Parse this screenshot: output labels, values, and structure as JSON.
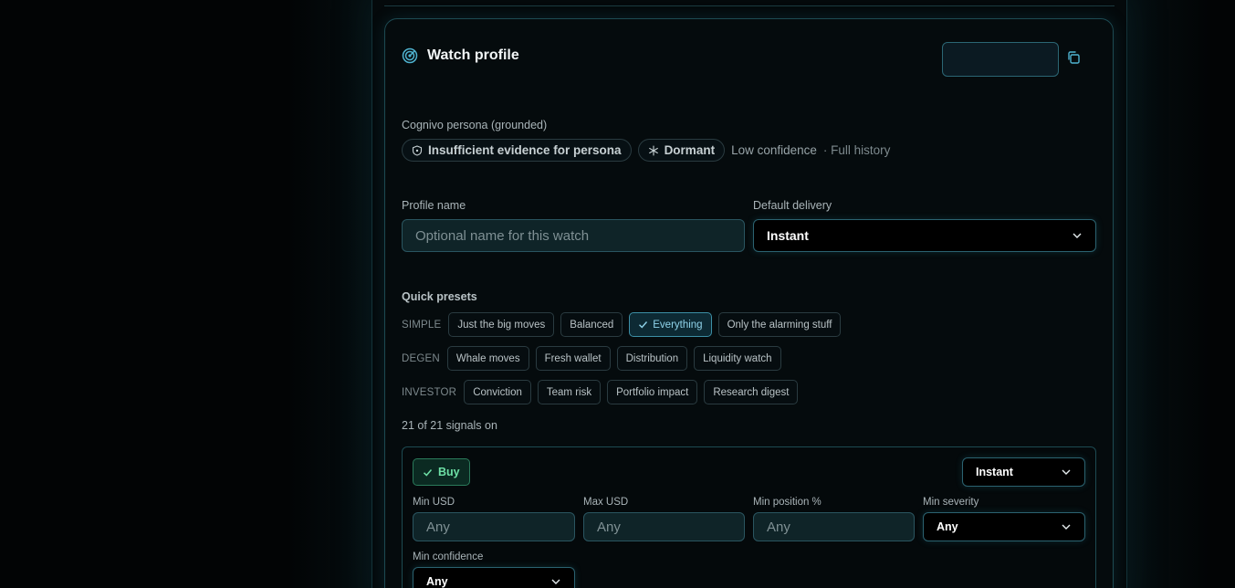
{
  "watch_profile": {
    "title": "Watch profile",
    "icons": {
      "title": "radar-icon",
      "copy": "copy-icon"
    }
  },
  "persona": {
    "label": "Cognivo persona (grounded)",
    "evidence_pill": "Insufficient evidence for persona",
    "state_pill": "Dormant",
    "confidence": "Low confidence",
    "history": "· Full history"
  },
  "profile_name": {
    "label": "Profile name",
    "placeholder": "Optional name for this watch"
  },
  "default_delivery": {
    "label": "Default delivery",
    "value": "Instant"
  },
  "quick_presets": {
    "label": "Quick presets",
    "rows": [
      {
        "tag": "SIMPLE",
        "chips": [
          "Just the big moves",
          "Balanced",
          "Everything",
          "Only the alarming stuff"
        ],
        "active_index": 2
      },
      {
        "tag": "DEGEN",
        "chips": [
          "Whale moves",
          "Fresh wallet",
          "Distribution",
          "Liquidity watch"
        ]
      },
      {
        "tag": "INVESTOR",
        "chips": [
          "Conviction",
          "Team risk",
          "Portfolio impact",
          "Research digest"
        ]
      }
    ]
  },
  "signals_summary": "21 of 21 signals on",
  "signal": {
    "name": "Buy",
    "enabled": true,
    "delivery": "Instant",
    "min_usd": {
      "label": "Min USD",
      "placeholder": "Any"
    },
    "max_usd": {
      "label": "Max USD",
      "placeholder": "Any"
    },
    "min_position": {
      "label": "Min position %",
      "placeholder": "Any"
    },
    "min_severity": {
      "label": "Min severity",
      "value": "Any"
    },
    "min_confidence": {
      "label": "Min confidence",
      "value": "Any"
    }
  },
  "colors": {
    "accent": "#3d8fa6",
    "active_chip_text": "#8fd3ea",
    "buy_green": "#6ee0a6",
    "background": "#020405"
  }
}
